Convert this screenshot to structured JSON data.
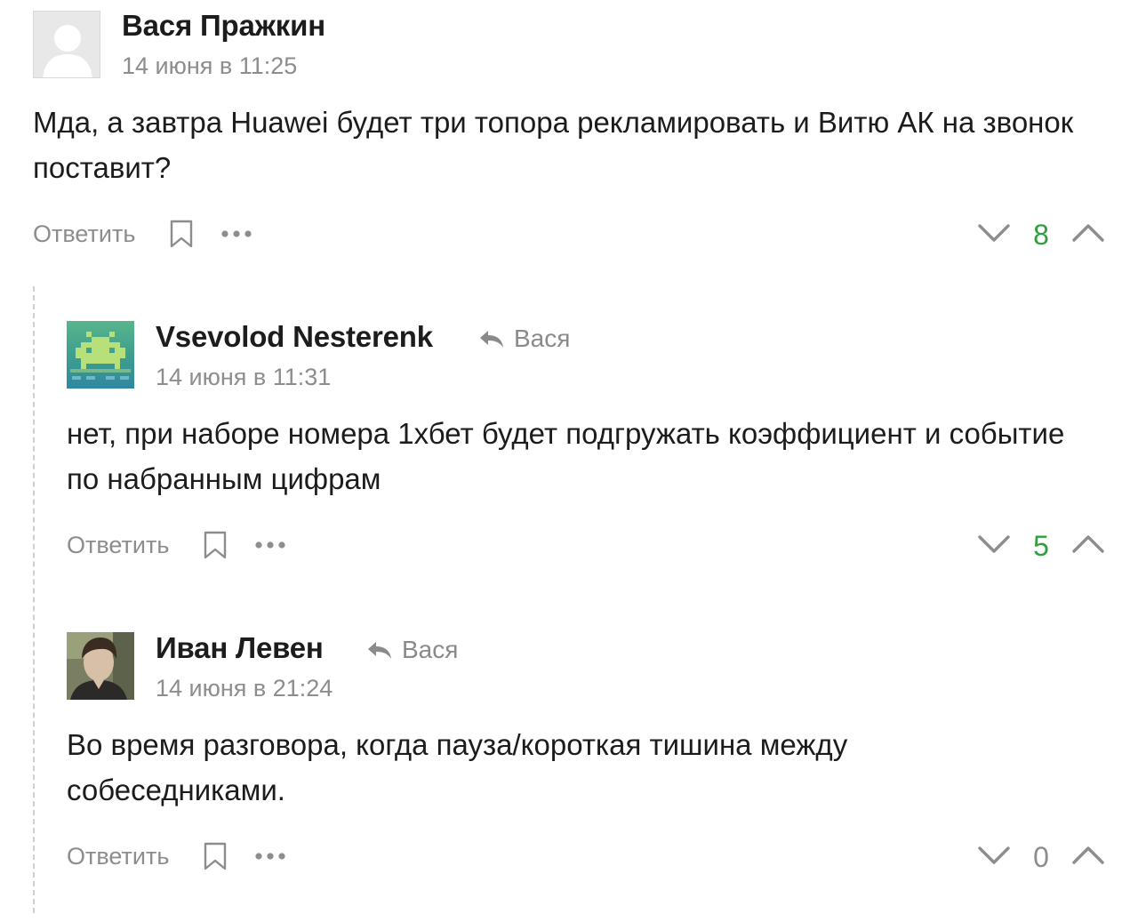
{
  "comments": [
    {
      "author": "Вася Пражкин",
      "reply_to": "",
      "date": "14 июня в 11:25",
      "text": "Мда, а завтра Huawei будет три топора рекламировать и Витю АК на звонок поставит?",
      "reply_label": "Ответить",
      "score": "8",
      "avatar": "default-user-avatar"
    },
    {
      "author": "Vsevolod Nesterenk",
      "reply_to": "Вася",
      "date": "14 июня в 11:31",
      "text": "нет, при наборе номера 1хбет будет подгружать коэффициент и событие по набранным цифрам",
      "reply_label": "Ответить",
      "score": "5",
      "avatar": "space-invader-avatar"
    },
    {
      "author": "Иван Левен",
      "reply_to": "Вася",
      "date": "14 июня в 21:24",
      "text": "Во время разговора, когда пауза/короткая тишина между собеседниками.",
      "reply_label": "Ответить",
      "score": "0",
      "avatar": "photo-avatar"
    }
  ],
  "colors": {
    "score_positive": "#2e9e3e",
    "score_neutral": "#8d8d8d",
    "muted_text": "#8d8d8d"
  },
  "icons": [
    "bookmark-icon",
    "more-icon",
    "downvote-icon",
    "upvote-icon",
    "reply-arrow-icon"
  ]
}
